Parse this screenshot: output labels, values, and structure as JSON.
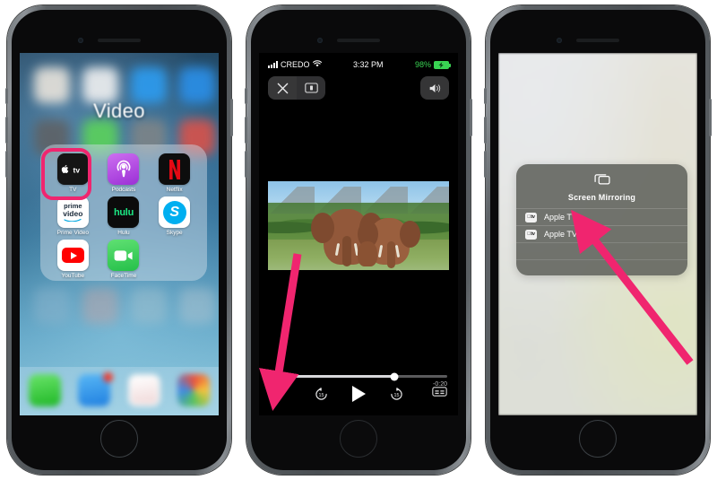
{
  "accent": {
    "arrow_pink": "#f0256f",
    "highlight_pink": "#f0256f",
    "battery_green": "#39d353"
  },
  "phone1": {
    "name": "iphone-home-screen",
    "folder_title": "Video",
    "apps": [
      {
        "label": "TV",
        "icon": "apple-tv-icon",
        "highlighted": true
      },
      {
        "label": "Podcasts",
        "icon": "podcasts-icon",
        "highlighted": false
      },
      {
        "label": "Netflix",
        "icon": "netflix-icon",
        "highlighted": false
      },
      {
        "label": "Prime Video",
        "icon": "prime-video-icon",
        "highlighted": false
      },
      {
        "label": "Hulu",
        "icon": "hulu-icon",
        "highlighted": false
      },
      {
        "label": "Skype",
        "icon": "skype-icon",
        "highlighted": false
      },
      {
        "label": "YouTube",
        "icon": "youtube-icon",
        "highlighted": false
      },
      {
        "label": "FaceTime",
        "icon": "facetime-icon",
        "highlighted": false
      }
    ],
    "dock": [
      {
        "name": "phone-app-icon",
        "badge": ""
      },
      {
        "name": "messages-app-icon",
        "badge": "1"
      },
      {
        "name": "mail-app-icon",
        "badge": ""
      },
      {
        "name": "photos-app-icon",
        "badge": ""
      }
    ]
  },
  "phone2": {
    "name": "iphone-video-player",
    "statusbar": {
      "carrier": "CREDO",
      "time": "3:32 PM",
      "battery": "98%"
    },
    "controls": {
      "close_label": "✕",
      "pip_name": "picture-in-picture-button",
      "mute_name": "mute-button"
    },
    "player": {
      "elapsed": "",
      "remaining": "-0:20",
      "progress_percent": 70,
      "airplay_label": "airplay-button",
      "skip_back_label": "15",
      "skip_fwd_label": "15",
      "play_label": "play-button",
      "captions_label": "captions-button"
    },
    "video_alt": "Two elephants walking in green brush"
  },
  "phone3": {
    "name": "iphone-screen-mirroring",
    "panel": {
      "title": "Screen Mirroring",
      "icon": "screen-mirroring-icon",
      "devices": [
        {
          "label": "Apple TV",
          "icon": "apple-tv-small-icon"
        },
        {
          "label": "Apple TV",
          "icon": "apple-tv-small-icon"
        }
      ],
      "empty_rows": 2
    }
  },
  "annotations": [
    {
      "name": "arrow-to-airplay-button",
      "target": "phone2 airplay button",
      "direction": "down"
    },
    {
      "name": "arrow-to-apple-tv-device",
      "target": "phone3 first Apple TV row",
      "direction": "up-left"
    }
  ]
}
